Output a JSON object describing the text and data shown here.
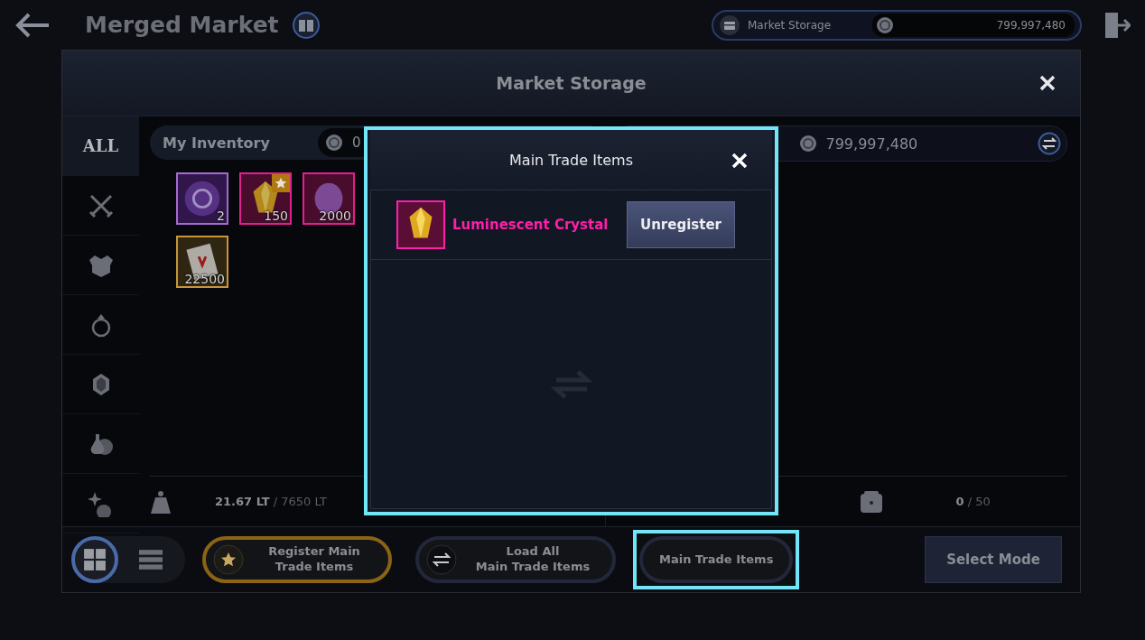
{
  "top_bar": {
    "title": "Merged Market",
    "storage_label": "Market Storage",
    "storage_silver": "799,997,480"
  },
  "modal": {
    "title": "Market Storage"
  },
  "categories": [
    {
      "kind": "text",
      "label": "ALL",
      "selected": true
    },
    {
      "kind": "swords",
      "selected": false
    },
    {
      "kind": "armor",
      "selected": false
    },
    {
      "kind": "ring",
      "selected": false
    },
    {
      "kind": "gem",
      "selected": false
    },
    {
      "kind": "potion",
      "selected": false
    },
    {
      "kind": "sparkle",
      "selected": false
    }
  ],
  "inventory": {
    "title": "My Inventory",
    "silver": "0",
    "weight": "21.67 LT",
    "weight_max": "/ 7650 LT",
    "items": [
      {
        "kind": "orb",
        "count": "2",
        "color": "#a46ad0",
        "starred": false
      },
      {
        "kind": "crystal",
        "count": "150",
        "color": "#e0208f",
        "starred": true
      },
      {
        "kind": "feather",
        "count": "2000",
        "color": "#e0208f",
        "starred": false
      },
      {
        "kind": "scroll",
        "count": "22500",
        "color": "#c8963a",
        "starred": false
      }
    ]
  },
  "storage": {
    "silver": "799,997,480",
    "slots": "0",
    "slots_max": "/ 50"
  },
  "toolbar": {
    "view_modes": [
      {
        "kind": "grid",
        "selected": true
      },
      {
        "kind": "list",
        "selected": false
      }
    ],
    "buttons": [
      {
        "kind": "register",
        "label": "Register Main Trade Items",
        "highlighted": false
      },
      {
        "kind": "load",
        "label": "Load All\nMain Trade Items",
        "highlighted": false
      },
      {
        "kind": "plain",
        "label": "Main Trade Items",
        "highlighted": true
      }
    ],
    "select_mode": "Select Mode"
  },
  "popup": {
    "title": "Main Trade Items",
    "items": [
      {
        "name": "Luminescent Crystal",
        "color": "#ff1eaa",
        "action": "Unregister"
      }
    ]
  }
}
